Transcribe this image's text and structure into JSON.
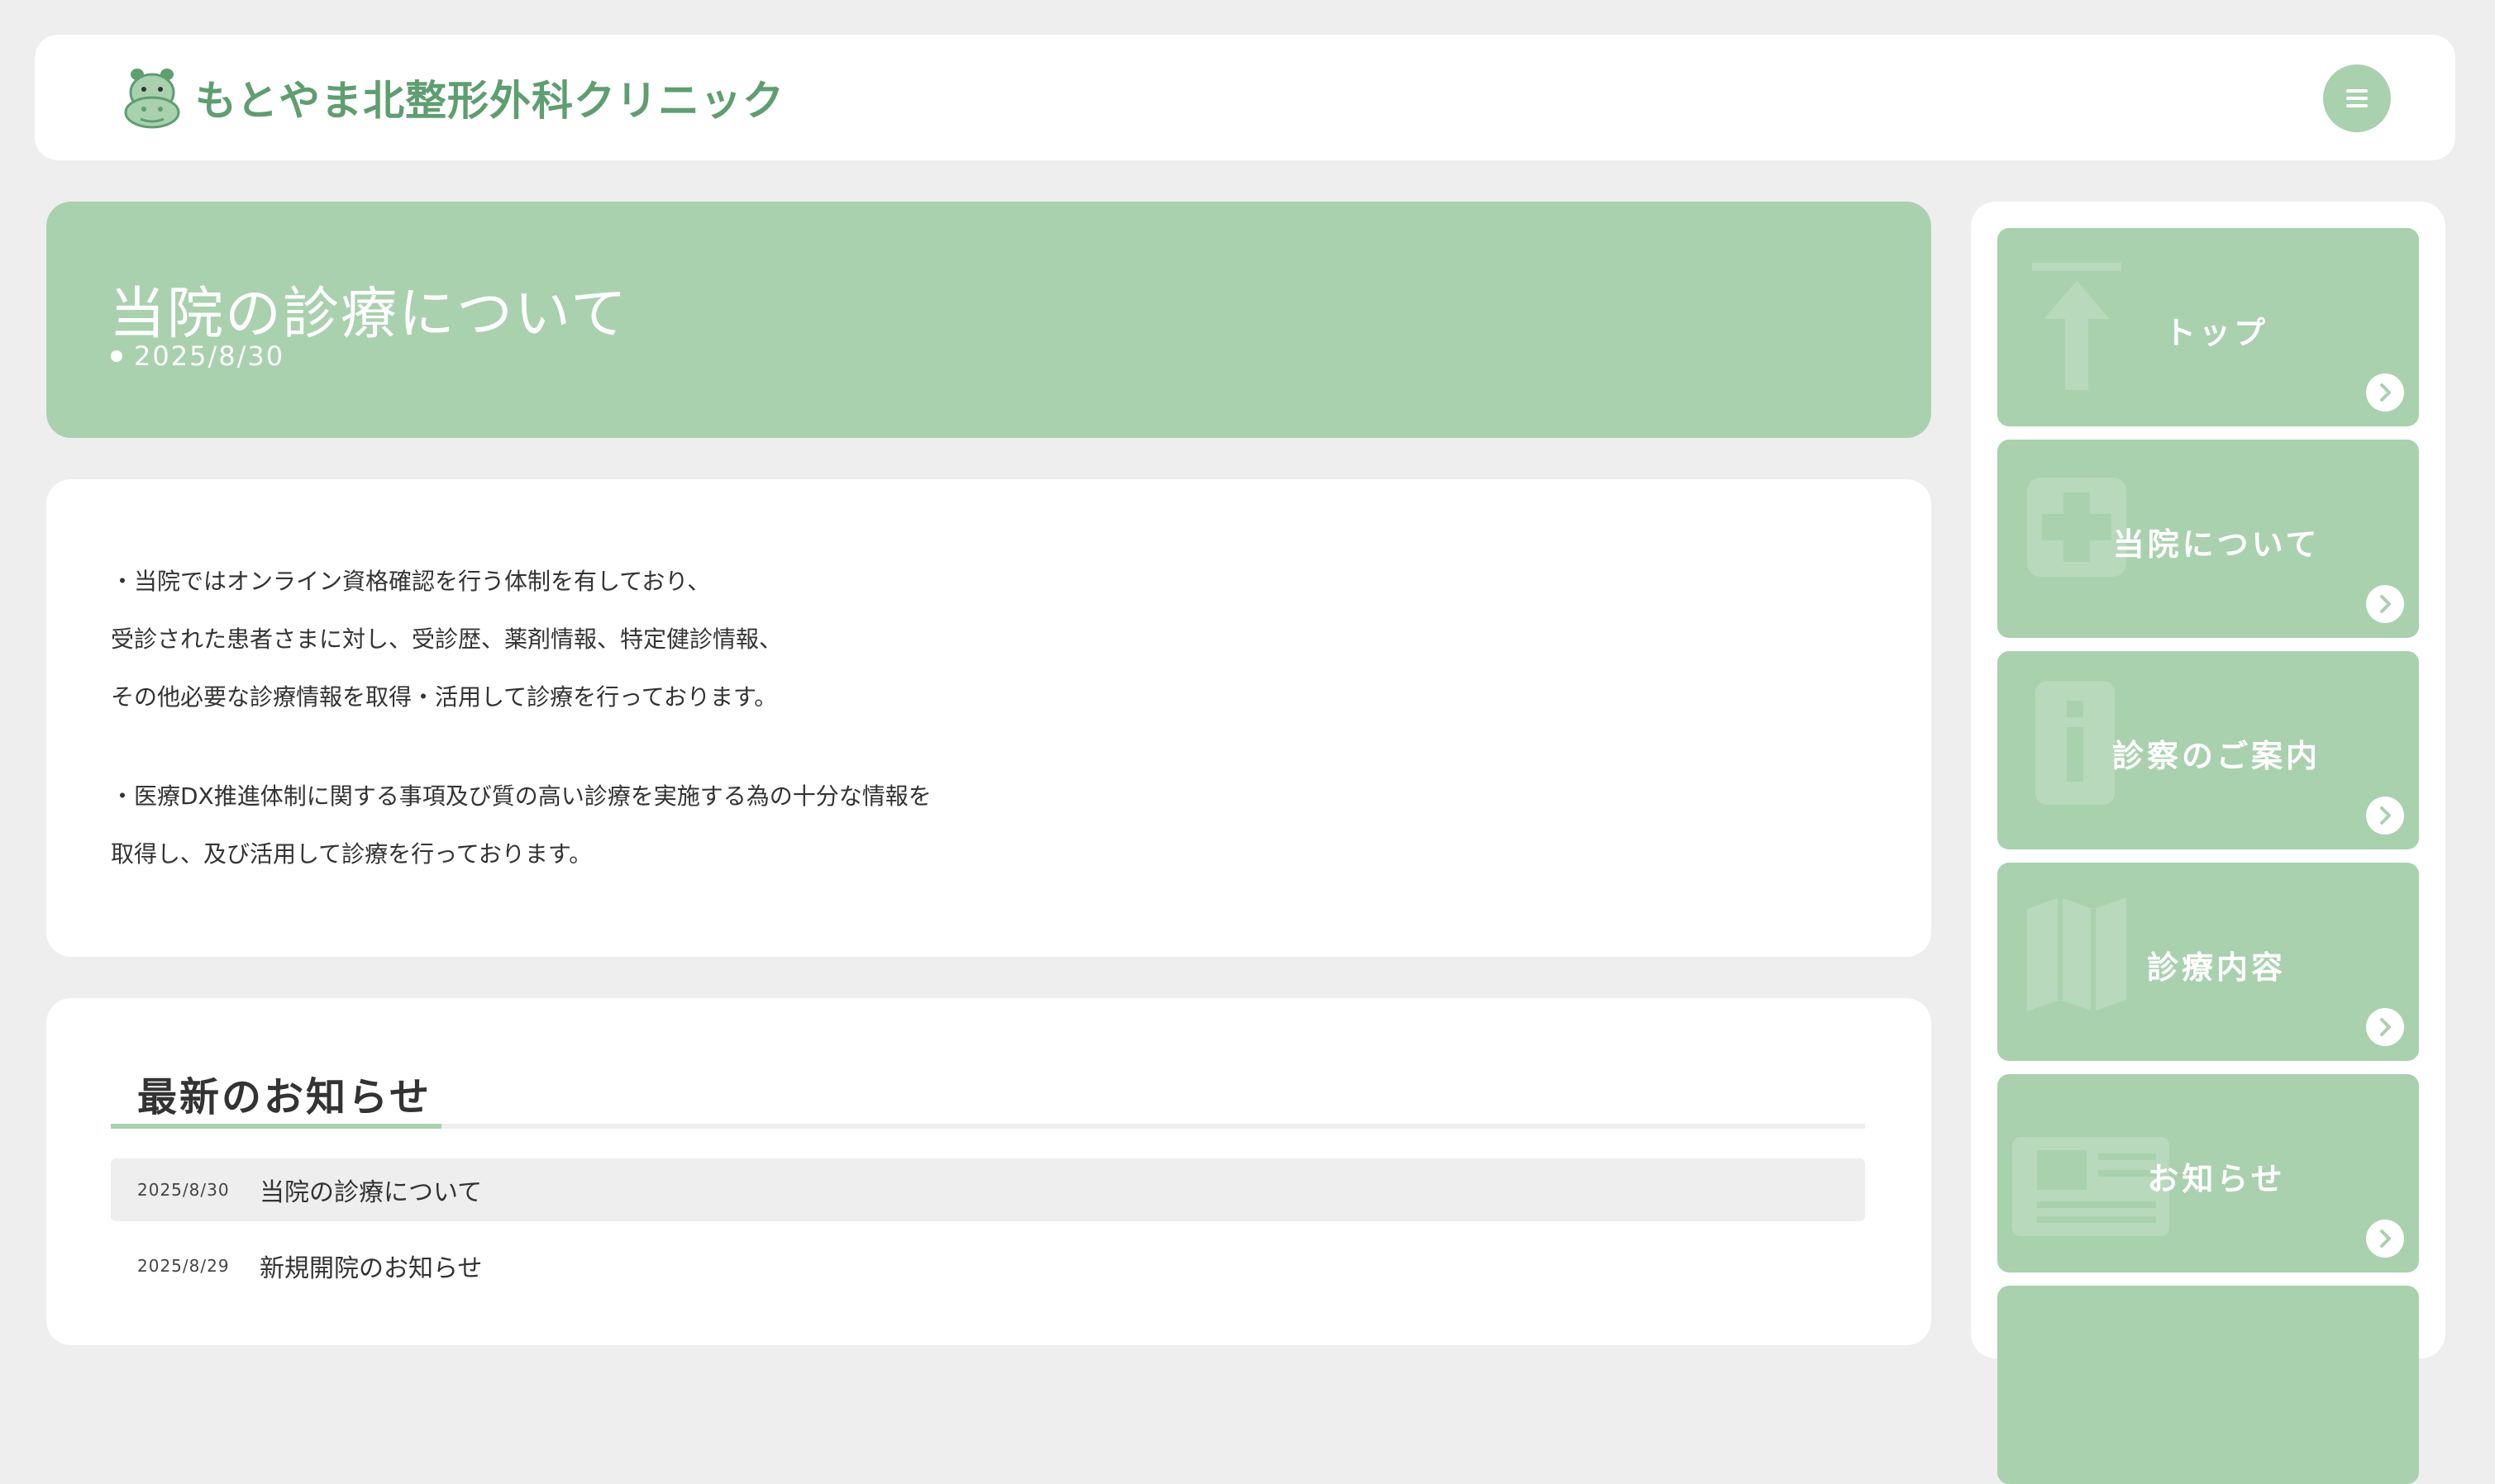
{
  "header": {
    "site_name": "もとやま北整形外科クリニック",
    "logo_icon": "hippo-icon",
    "menu_icon": "hamburger-menu-icon"
  },
  "banner": {
    "title": "当院の診療について",
    "date": "2025/8/30"
  },
  "article": {
    "paragraphs": [
      "・当院ではオンライン資格確認を行う体制を有しており、",
      "受診された患者さまに対し、受診歴、薬剤情報、特定健診情報、",
      "その他必要な診療情報を取得・活用して診療を行っております。",
      "・医療DX推進体制に関する事項及び質の高い診療を実施する為の十分な情報を",
      "取得し、及び活用して診療を行っております。"
    ]
  },
  "news": {
    "heading": "最新のお知らせ",
    "items": [
      {
        "date": "2025/8/30",
        "title": "当院の診療について"
      },
      {
        "date": "2025/8/29",
        "title": "新規開院のお知らせ"
      }
    ]
  },
  "sidebar": {
    "items": [
      {
        "label": "トップ",
        "icon": "arrow-up-icon"
      },
      {
        "label": "当院について",
        "icon": "medical-cross-icon"
      },
      {
        "label": "診察のご案内",
        "icon": "info-icon"
      },
      {
        "label": "診療内容",
        "icon": "map-icon"
      },
      {
        "label": "お知らせ",
        "icon": "newspaper-icon"
      }
    ]
  },
  "colors": {
    "accent": "#a9d1ae",
    "brand_text": "#5e9e70",
    "background": "#eeeeee"
  }
}
